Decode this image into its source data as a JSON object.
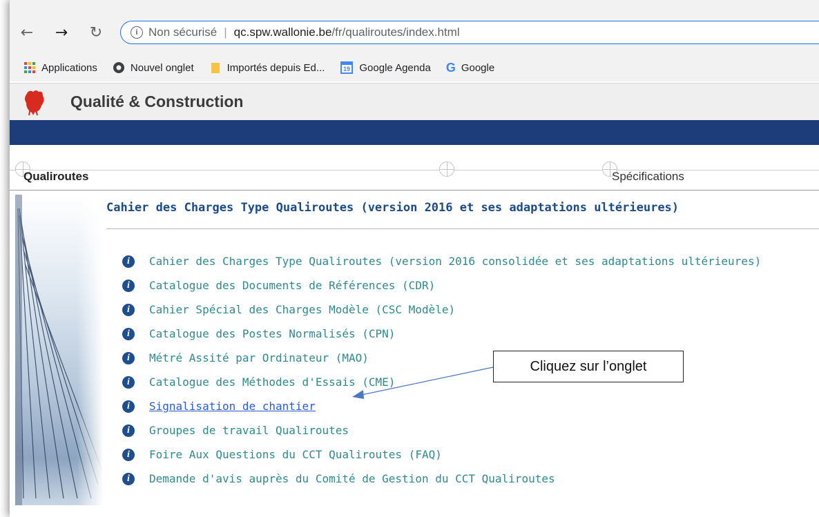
{
  "browser": {
    "security_label": "Non sécurisé",
    "url_host": "qc.spw.wallonie.be",
    "url_path": "/fr/qualiroutes/index.html",
    "bookmarks": [
      {
        "label": "Applications",
        "icon": "apps-grid-icon"
      },
      {
        "label": "Nouvel onglet",
        "icon": "chrome-icon"
      },
      {
        "label": "Importés depuis Ed...",
        "icon": "folder-icon"
      },
      {
        "label": "Google Agenda",
        "icon": "calendar-icon",
        "badge": "19"
      },
      {
        "label": "Google",
        "icon": "google-icon"
      }
    ]
  },
  "site": {
    "title": "Qualité & Construction",
    "header_color": "#1c3d7a"
  },
  "tabs": {
    "left": "Qualiroutes",
    "right": "Spécifications"
  },
  "content": {
    "title": "Cahier des Charges Type Qualiroutes (version 2016 et ses adaptations ultérieures)",
    "links": [
      {
        "label": "Cahier des Charges Type Qualiroutes (version 2016 consolidée et ses adaptations ultérieures)",
        "active": false
      },
      {
        "label": "Catalogue des Documents de Références (CDR)",
        "active": false
      },
      {
        "label": "Cahier Spécial des Charges Modèle (CSC Modèle)",
        "active": false
      },
      {
        "label": "Catalogue des Postes Normalisés (CPN)",
        "active": false
      },
      {
        "label": "Métré Assité par Ordinateur (MAO)",
        "active": false
      },
      {
        "label": "Catalogue des Méthodes d'Essais (CME)",
        "active": false
      },
      {
        "label": "Signalisation de chantier",
        "active": true
      },
      {
        "label": "Groupes de travail Qualiroutes",
        "active": false
      },
      {
        "label": "Foire Aux Questions du CCT Qualiroutes (FAQ)",
        "active": false
      },
      {
        "label": "Demande d'avis auprès du Comité de Gestion du CCT Qualiroutes",
        "active": false
      }
    ]
  },
  "annotation": {
    "callout": "Cliquez sur l’onglet"
  }
}
